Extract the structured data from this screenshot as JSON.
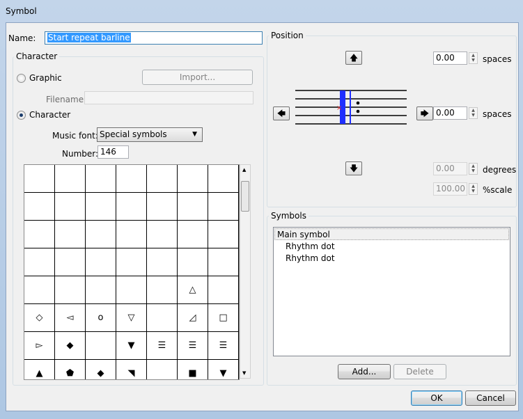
{
  "window": {
    "title": "Symbol"
  },
  "name_field": {
    "label": "Name:",
    "value": "Start repeat barline"
  },
  "character_group": {
    "title": "Character",
    "graphic_label": "Graphic",
    "import_label": "Import...",
    "filename_label": "Filename:",
    "filename_value": "",
    "character_label": "Character",
    "music_font_label": "Music font:",
    "music_font_value": "Special symbols",
    "number_label": "Number:",
    "number_value": "146",
    "selected_mode": "Character"
  },
  "glyph_grid": {
    "rows": [
      [
        "",
        "",
        "",
        "",
        "",
        "",
        ""
      ],
      [
        "",
        "",
        "",
        "",
        "",
        "",
        ""
      ],
      [
        "",
        "",
        "",
        "",
        "",
        "",
        ""
      ],
      [
        "",
        "",
        "",
        "",
        "",
        "",
        ""
      ],
      [
        "",
        "",
        "",
        "",
        "",
        "△",
        ""
      ],
      [
        "◇",
        "◅",
        "o",
        "▽",
        "",
        "◿",
        "□"
      ],
      [
        "▻",
        "◆",
        "",
        "▼",
        "☰",
        "☰",
        "☰"
      ],
      [
        "▲",
        "⬟",
        "◆",
        "◥",
        "",
        "■",
        "▼"
      ]
    ]
  },
  "position_group": {
    "title": "Position",
    "vertical_value": "0.00",
    "vertical_unit": "spaces",
    "horizontal_value": "0.00",
    "horizontal_unit": "spaces",
    "rotation_value": "0.00",
    "rotation_unit": "degrees",
    "scale_value": "100.00",
    "scale_unit": "%scale"
  },
  "symbols_group": {
    "title": "Symbols",
    "items": [
      "Main symbol",
      "Rhythm dot",
      "Rhythm dot"
    ],
    "selected_index": 0,
    "add_label": "Add...",
    "delete_label": "Delete"
  },
  "footer": {
    "ok_label": "OK",
    "cancel_label": "Cancel"
  },
  "colors": {
    "selection": "#3399ff",
    "barline_blue": "#1f2fff",
    "anchor_red": "#e03030"
  }
}
